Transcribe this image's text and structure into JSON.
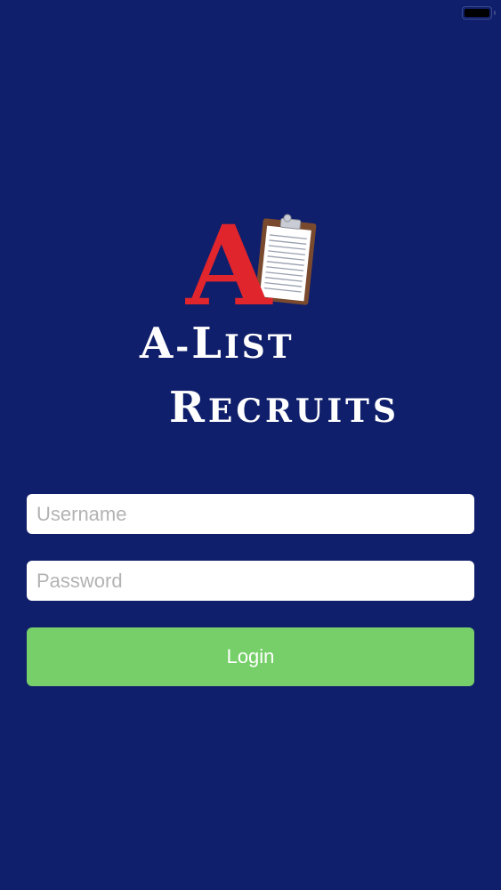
{
  "app": {
    "brand_line1": "A-List",
    "brand_line2": "Recruits",
    "logo_letter": "A"
  },
  "form": {
    "username_placeholder": "Username",
    "username_value": "",
    "password_placeholder": "Password",
    "password_value": "",
    "login_label": "Login"
  },
  "colors": {
    "background": "#101f6b",
    "logo_red": "#e0252c",
    "login_green": "#76cf68",
    "clipboard_brown": "#7a4a2f"
  },
  "icons": {
    "logo": "clipboard-icon",
    "status": "battery-icon"
  }
}
